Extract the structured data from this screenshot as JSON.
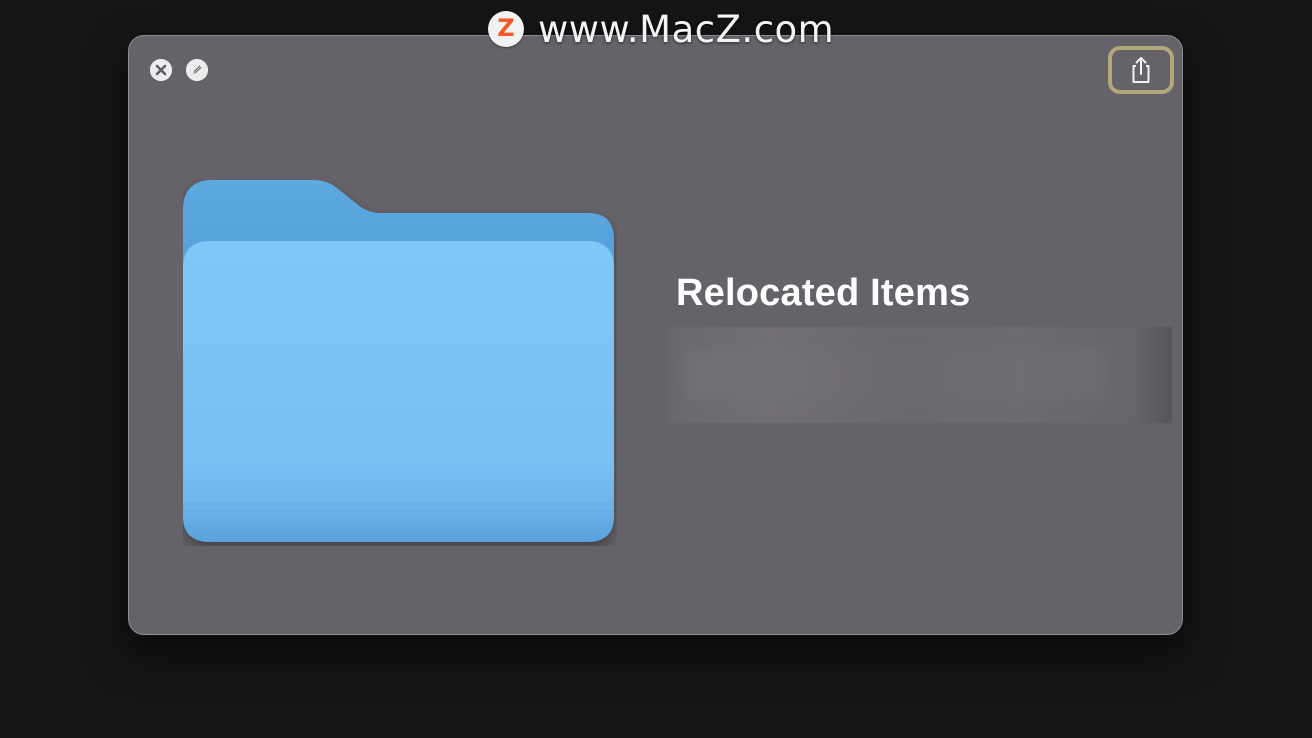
{
  "watermark": {
    "logo_letter": "Z",
    "text": "www.MacZ.com"
  },
  "quicklook": {
    "title": "Relocated Items",
    "buttons": {
      "close": "close-icon",
      "markup": "markup-icon",
      "share": "share-icon"
    },
    "accent_highlight": "#b3a67a",
    "window_bg": "#656369",
    "folder_color": "#5aaee8"
  }
}
